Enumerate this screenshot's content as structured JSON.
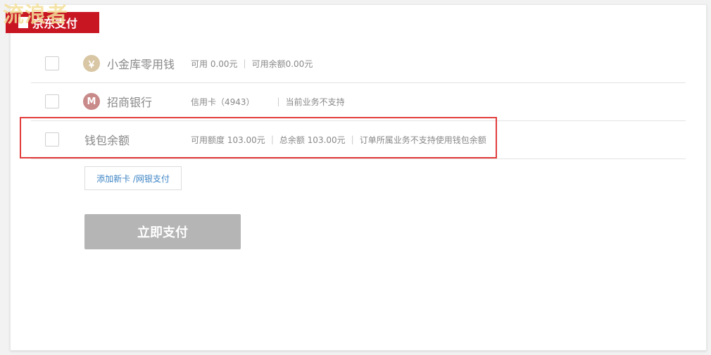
{
  "watermark": "流浪者",
  "header": {
    "title": "京东支付"
  },
  "methods": [
    {
      "name": "小金库零用钱",
      "icon": "money-bag-icon",
      "details": [
        "可用 0.00元",
        "可用余额0.00元"
      ]
    },
    {
      "name": "招商银行",
      "icon": "cmb-bank-icon",
      "details": [
        "信用卡（4943）",
        "当前业务不支持"
      ]
    },
    {
      "name": "钱包余额",
      "icon": "",
      "details": [
        "可用额度 103.00元",
        "总余额 103.00元",
        "订单所属业务不支持使用钱包余额"
      ]
    }
  ],
  "actions": {
    "add_card": "添加新卡 /网银支付",
    "pay_now": "立即支付"
  },
  "colors": {
    "brand_red": "#c81623",
    "highlight": "#e23b3b",
    "disabled_button": "#b5b5b5",
    "link": "#3e85c5"
  }
}
